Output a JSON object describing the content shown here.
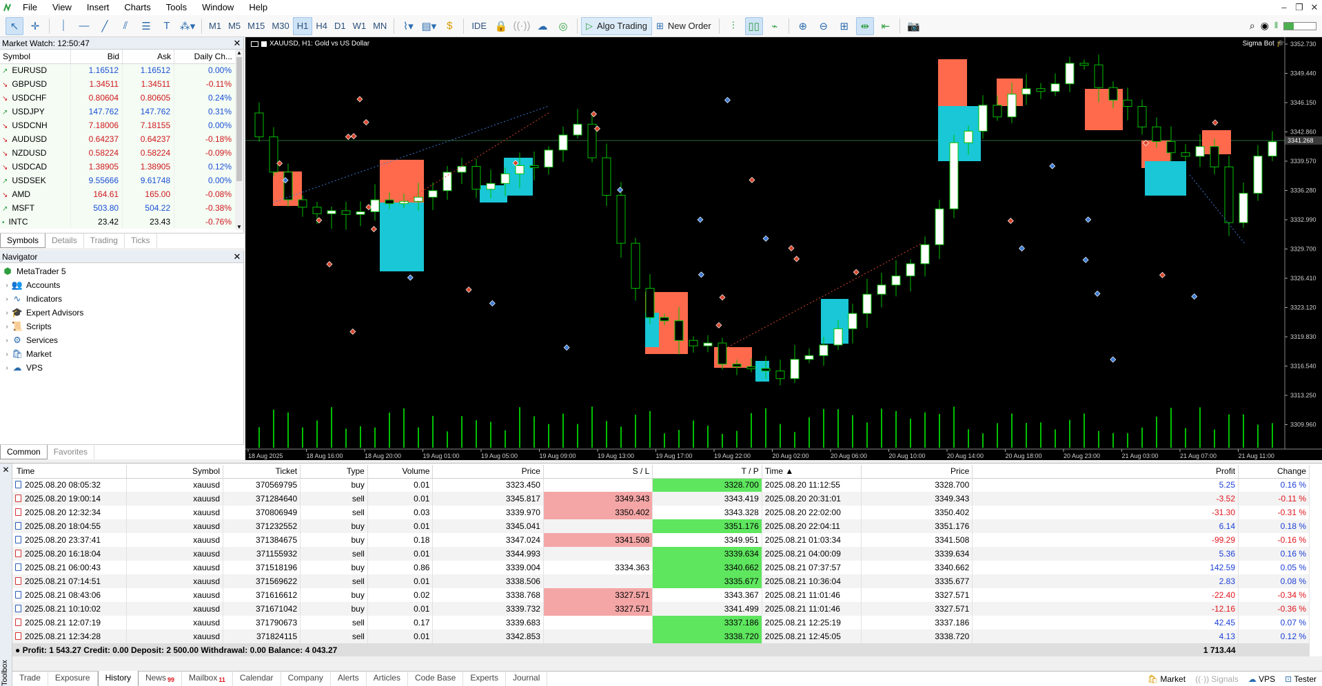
{
  "menu": [
    "File",
    "View",
    "Insert",
    "Charts",
    "Tools",
    "Window",
    "Help"
  ],
  "toolbar": {
    "timeframes": [
      "M1",
      "M5",
      "M15",
      "M30",
      "H1",
      "H4",
      "D1",
      "W1",
      "MN"
    ],
    "active_timeframe": "H1",
    "ide": "IDE",
    "algo_trading": "Algo Trading",
    "new_order": "New Order",
    "level_percent": 0.3
  },
  "market_watch": {
    "title": "Market Watch: 12:50:47",
    "columns": [
      "Symbol",
      "Bid",
      "Ask",
      "Daily Ch..."
    ],
    "rows": [
      {
        "symbol": "EURUSD",
        "bid": "1.16512",
        "ask": "1.16512",
        "change": "0.00%",
        "dir": "up"
      },
      {
        "symbol": "GBPUSD",
        "bid": "1.34511",
        "ask": "1.34511",
        "change": "-0.11%",
        "dir": "down"
      },
      {
        "symbol": "USDCHF",
        "bid": "0.80604",
        "ask": "0.80605",
        "change": "0.24%",
        "dir": "down"
      },
      {
        "symbol": "USDJPY",
        "bid": "147.762",
        "ask": "147.762",
        "change": "0.31%",
        "dir": "up"
      },
      {
        "symbol": "USDCNH",
        "bid": "7.18006",
        "ask": "7.18155",
        "change": "0.00%",
        "dir": "down"
      },
      {
        "symbol": "AUDUSD",
        "bid": "0.64237",
        "ask": "0.64237",
        "change": "-0.18%",
        "dir": "down"
      },
      {
        "symbol": "NZDUSD",
        "bid": "0.58224",
        "ask": "0.58224",
        "change": "-0.09%",
        "dir": "down"
      },
      {
        "symbol": "USDCAD",
        "bid": "1.38905",
        "ask": "1.38905",
        "change": "0.12%",
        "dir": "down"
      },
      {
        "symbol": "USDSEK",
        "bid": "9.55666",
        "ask": "9.61748",
        "change": "0.00%",
        "dir": "up"
      },
      {
        "symbol": "AMD",
        "bid": "164.61",
        "ask": "165.00",
        "change": "-0.08%",
        "dir": "down"
      },
      {
        "symbol": "MSFT",
        "bid": "503.80",
        "ask": "504.22",
        "change": "-0.38%",
        "dir": "up"
      },
      {
        "symbol": "INTC",
        "bid": "23.42",
        "ask": "23.43",
        "change": "-0.76%",
        "dir": "flat"
      }
    ],
    "tabs": [
      "Symbols",
      "Details",
      "Trading",
      "Ticks"
    ],
    "active_tab": "Symbols"
  },
  "navigator": {
    "title": "Navigator",
    "root": "MetaTrader 5",
    "items": [
      {
        "label": "Accounts",
        "icon": "accounts-icon",
        "glyph": "👥"
      },
      {
        "label": "Indicators",
        "icon": "indicators-icon",
        "glyph": "∿"
      },
      {
        "label": "Expert Advisors",
        "icon": "expert-advisors-icon",
        "glyph": "🎓"
      },
      {
        "label": "Scripts",
        "icon": "scripts-icon",
        "glyph": "📜"
      },
      {
        "label": "Services",
        "icon": "services-icon",
        "glyph": "⚙"
      },
      {
        "label": "Market",
        "icon": "market-icon",
        "glyph": "🛍"
      },
      {
        "label": "VPS",
        "icon": "vps-icon",
        "glyph": "☁"
      }
    ],
    "tabs": [
      "Common",
      "Favorites"
    ],
    "active_tab": "Common"
  },
  "chart": {
    "title": "XAUUSD, H1:  Gold vs US Dollar",
    "bot": "Sigma Bot",
    "current_price": "3341.268",
    "price_labels": [
      "3352.730",
      "3349.440",
      "3346.150",
      "3342.860",
      "3339.570",
      "3336.280",
      "3332.990",
      "3329.700",
      "3326.410",
      "3323.120",
      "3319.830",
      "3316.540",
      "3313.250",
      "3309.960"
    ],
    "time_labels": [
      "18 Aug 2025",
      "18 Aug 16:00",
      "18 Aug 20:00",
      "19 Aug 01:00",
      "19 Aug 05:00",
      "19 Aug 09:00",
      "19 Aug 13:00",
      "19 Aug 17:00",
      "19 Aug 22:00",
      "20 Aug 02:00",
      "20 Aug 06:00",
      "20 Aug 10:00",
      "20 Aug 14:00",
      "20 Aug 18:00",
      "20 Aug 23:00",
      "21 Aug 03:00",
      "21 Aug 07:00",
      "21 Aug 11:00"
    ],
    "colors": {
      "bull": "#ffffff",
      "bear": "#000000",
      "wick": "#00c000",
      "buy_zone": "#19c7d6",
      "sell_zone": "#ff6a4d",
      "grid_line": "#2e6b3a"
    }
  },
  "history": {
    "columns": [
      "Time",
      "Symbol",
      "Ticket",
      "Type",
      "Volume",
      "Price",
      "S / L",
      "T / P",
      "Time",
      "Price",
      "Profit",
      "Change"
    ],
    "rows": [
      {
        "time": "2025.08.20 08:05:32",
        "symbol": "xauusd",
        "ticket": "370569795",
        "type": "buy",
        "volume": "0.01",
        "price": "3323.450",
        "sl": "",
        "tp": "3328.700",
        "hit": "tp",
        "close_time": "2025.08.20 11:12:55",
        "close_price": "3328.700",
        "profit": "5.25",
        "change": "0.16 %"
      },
      {
        "time": "2025.08.20 19:00:14",
        "symbol": "xauusd",
        "ticket": "371284640",
        "type": "sell",
        "volume": "0.01",
        "price": "3345.817",
        "sl": "3349.343",
        "tp": "3343.419",
        "hit": "sl",
        "close_time": "2025.08.20 20:31:01",
        "close_price": "3349.343",
        "profit": "-3.52",
        "change": "-0.11 %"
      },
      {
        "time": "2025.08.20 12:32:34",
        "symbol": "xauusd",
        "ticket": "370806949",
        "type": "sell",
        "volume": "0.03",
        "price": "3339.970",
        "sl": "3350.402",
        "tp": "3343.328",
        "hit": "sl",
        "close_time": "2025.08.20 22:02:00",
        "close_price": "3350.402",
        "profit": "-31.30",
        "change": "-0.31 %"
      },
      {
        "time": "2025.08.20 18:04:55",
        "symbol": "xauusd",
        "ticket": "371232552",
        "type": "buy",
        "volume": "0.01",
        "price": "3345.041",
        "sl": "",
        "tp": "3351.176",
        "hit": "tp",
        "close_time": "2025.08.20 22:04:11",
        "close_price": "3351.176",
        "profit": "6.14",
        "change": "0.18 %"
      },
      {
        "time": "2025.08.20 23:37:41",
        "symbol": "xauusd",
        "ticket": "371384675",
        "type": "buy",
        "volume": "0.18",
        "price": "3347.024",
        "sl": "3341.508",
        "tp": "3349.951",
        "hit": "sl",
        "close_time": "2025.08.21 01:03:34",
        "close_price": "3341.508",
        "profit": "-99.29",
        "change": "-0.16 %"
      },
      {
        "time": "2025.08.20 16:18:04",
        "symbol": "xauusd",
        "ticket": "371155932",
        "type": "sell",
        "volume": "0.01",
        "price": "3344.993",
        "sl": "",
        "tp": "3339.634",
        "hit": "tp",
        "close_time": "2025.08.21 04:00:09",
        "close_price": "3339.634",
        "profit": "5.36",
        "change": "0.16 %"
      },
      {
        "time": "2025.08.21 06:00:43",
        "symbol": "xauusd",
        "ticket": "371518196",
        "type": "buy",
        "volume": "0.86",
        "price": "3339.004",
        "sl": "3334.363",
        "tp": "3340.662",
        "hit": "tp",
        "close_time": "2025.08.21 07:37:57",
        "close_price": "3340.662",
        "profit": "142.59",
        "change": "0.05 %"
      },
      {
        "time": "2025.08.21 07:14:51",
        "symbol": "xauusd",
        "ticket": "371569622",
        "type": "sell",
        "volume": "0.01",
        "price": "3338.506",
        "sl": "",
        "tp": "3335.677",
        "hit": "tp",
        "close_time": "2025.08.21 10:36:04",
        "close_price": "3335.677",
        "profit": "2.83",
        "change": "0.08 %"
      },
      {
        "time": "2025.08.21 08:43:06",
        "symbol": "xauusd",
        "ticket": "371616612",
        "type": "buy",
        "volume": "0.02",
        "price": "3338.768",
        "sl": "3327.571",
        "tp": "3343.367",
        "hit": "sl",
        "close_time": "2025.08.21 11:01:46",
        "close_price": "3327.571",
        "profit": "-22.40",
        "change": "-0.34 %"
      },
      {
        "time": "2025.08.21 10:10:02",
        "symbol": "xauusd",
        "ticket": "371671042",
        "type": "buy",
        "volume": "0.01",
        "price": "3339.732",
        "sl": "3327.571",
        "tp": "3341.499",
        "hit": "sl",
        "close_time": "2025.08.21 11:01:46",
        "close_price": "3327.571",
        "profit": "-12.16",
        "change": "-0.36 %"
      },
      {
        "time": "2025.08.21 12:07:19",
        "symbol": "xauusd",
        "ticket": "371790673",
        "type": "sell",
        "volume": "0.17",
        "price": "3339.683",
        "sl": "",
        "tp": "3337.186",
        "hit": "tp",
        "close_time": "2025.08.21 12:25:19",
        "close_price": "3337.186",
        "profit": "42.45",
        "change": "0.07 %"
      },
      {
        "time": "2025.08.21 12:34:28",
        "symbol": "xauusd",
        "ticket": "371824115",
        "type": "sell",
        "volume": "0.01",
        "price": "3342.853",
        "sl": "",
        "tp": "3338.720",
        "hit": "tp",
        "close_time": "2025.08.21 12:45:05",
        "close_price": "3338.720",
        "profit": "4.13",
        "change": "0.12 %"
      }
    ],
    "summary": "Profit: 1 543.27  Credit: 0.00  Deposit: 2 500.00  Withdrawal: 0.00  Balance: 4 043.27",
    "summary_total": "1 713.44"
  },
  "toolbox": {
    "label": "Toolbox",
    "tabs": [
      {
        "label": "Trade",
        "badge": ""
      },
      {
        "label": "Exposure",
        "badge": ""
      },
      {
        "label": "History",
        "badge": ""
      },
      {
        "label": "News",
        "badge": "99"
      },
      {
        "label": "Mailbox",
        "badge": "11"
      },
      {
        "label": "Calendar",
        "badge": ""
      },
      {
        "label": "Company",
        "badge": ""
      },
      {
        "label": "Alerts",
        "badge": ""
      },
      {
        "label": "Articles",
        "badge": ""
      },
      {
        "label": "Code Base",
        "badge": ""
      },
      {
        "label": "Experts",
        "badge": ""
      },
      {
        "label": "Journal",
        "badge": ""
      }
    ],
    "active_tab": "History",
    "status": {
      "market": "Market",
      "signals": "Signals",
      "vps": "VPS",
      "tester": "Tester"
    }
  }
}
